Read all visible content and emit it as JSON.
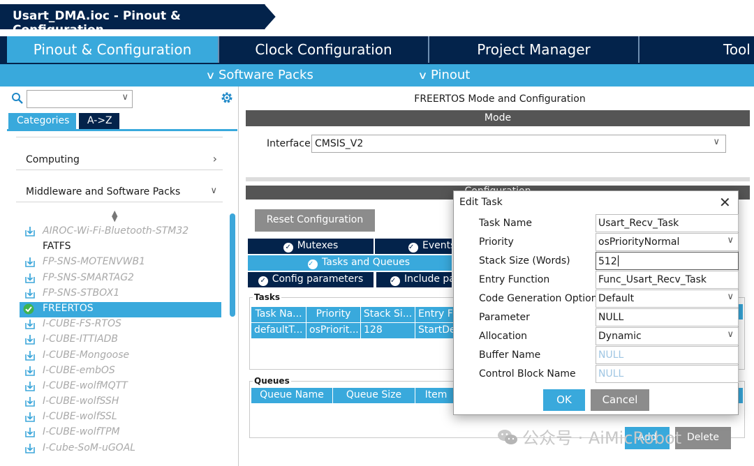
{
  "window": {
    "title": "Usart_DMA.ioc - Pinout & Configuration"
  },
  "tabs": [
    "Pinout & Configuration",
    "Clock Configuration",
    "Project Manager",
    "Tool"
  ],
  "submenus": [
    "Software Packs",
    "Pinout"
  ],
  "left": {
    "search_value": "",
    "category_tabs": [
      "Categories",
      "A->Z"
    ],
    "sections": [
      {
        "label": "Computing",
        "arrow": "chevron-right"
      },
      {
        "label": "Middleware and Software Packs",
        "arrow": "chevron-down"
      }
    ],
    "packs": [
      {
        "label": "AIROC-Wi-Fi-Bluetooth-STM32",
        "state": "disabled",
        "icon": "download-icon"
      },
      {
        "label": "FATFS",
        "state": "enabled",
        "icon": "none"
      },
      {
        "label": "FP-SNS-MOTENVWB1",
        "state": "disabled",
        "icon": "download-icon"
      },
      {
        "label": "FP-SNS-SMARTAG2",
        "state": "disabled",
        "icon": "download-icon"
      },
      {
        "label": "FP-SNS-STBOX1",
        "state": "disabled",
        "icon": "download-icon"
      },
      {
        "label": "FREERTOS",
        "state": "selected",
        "icon": "check-circle-icon"
      },
      {
        "label": "I-CUBE-FS-RTOS",
        "state": "disabled",
        "icon": "download-icon"
      },
      {
        "label": "I-CUBE-ITTIADB",
        "state": "disabled",
        "icon": "download-icon"
      },
      {
        "label": "I-CUBE-Mongoose",
        "state": "disabled",
        "icon": "download-icon"
      },
      {
        "label": "I-CUBE-embOS",
        "state": "disabled",
        "icon": "download-icon"
      },
      {
        "label": "I-CUBE-wolfMQTT",
        "state": "disabled",
        "icon": "download-icon"
      },
      {
        "label": "I-CUBE-wolfSSH",
        "state": "disabled",
        "icon": "download-icon"
      },
      {
        "label": "I-CUBE-wolfSSL",
        "state": "disabled",
        "icon": "download-icon"
      },
      {
        "label": "I-CUBE-wolfTPM",
        "state": "disabled",
        "icon": "download-icon"
      },
      {
        "label": "I-Cube-SoM-uGOAL",
        "state": "disabled",
        "icon": "download-icon"
      }
    ]
  },
  "main": {
    "header": "FREERTOS Mode and Configuration",
    "mode_label": "Mode",
    "interface_label": "Interface",
    "interface_value": "CMSIS_V2",
    "config_label": "Configuration",
    "reset_button": "Reset Configuration",
    "config_tabs": {
      "row1": [
        "Mutexes",
        "Events"
      ],
      "row2": [
        "Tasks and Queues"
      ],
      "row3": [
        "Config parameters",
        "Include pa"
      ]
    },
    "tasks_group": "Tasks",
    "tasks_columns": [
      "Task Na...",
      "Priority",
      "Stack Si...",
      "Entry F"
    ],
    "tasks_rows": [
      [
        "defaultT...",
        "osPriorit...",
        "128",
        "StartDe"
      ]
    ],
    "queues_group": "Queues",
    "queues_columns": [
      "Queue Name",
      "Queue Size",
      "Item"
    ],
    "bottom_buttons": [
      "Add",
      "Delete"
    ]
  },
  "dialog": {
    "title": "Edit Task",
    "fields": [
      {
        "label": "Task Name",
        "value": "Usart_Recv_Task",
        "kind": "text"
      },
      {
        "label": "Priority",
        "value": "osPriorityNormal",
        "kind": "select"
      },
      {
        "label": "Stack Size (Words)",
        "value": "512",
        "kind": "text-focused"
      },
      {
        "label": "Entry Function",
        "value": "Func_Usart_Recv_Task",
        "kind": "text"
      },
      {
        "label": "Code Generation Option",
        "value": "Default",
        "kind": "select"
      },
      {
        "label": "Parameter",
        "value": "NULL",
        "kind": "text"
      },
      {
        "label": "Allocation",
        "value": "Dynamic",
        "kind": "select"
      },
      {
        "label": "Buffer Name",
        "value": "NULL",
        "kind": "placeholder"
      },
      {
        "label": "Control Block Name",
        "value": "NULL",
        "kind": "placeholder"
      }
    ],
    "ok": "OK",
    "cancel": "Cancel"
  },
  "watermark": "公众号 · AiMicRobot",
  "colors": {
    "navy": "#03234b",
    "accent": "#39a9dc",
    "gray_button": "#8c8c8c",
    "header_gray": "#555555"
  }
}
